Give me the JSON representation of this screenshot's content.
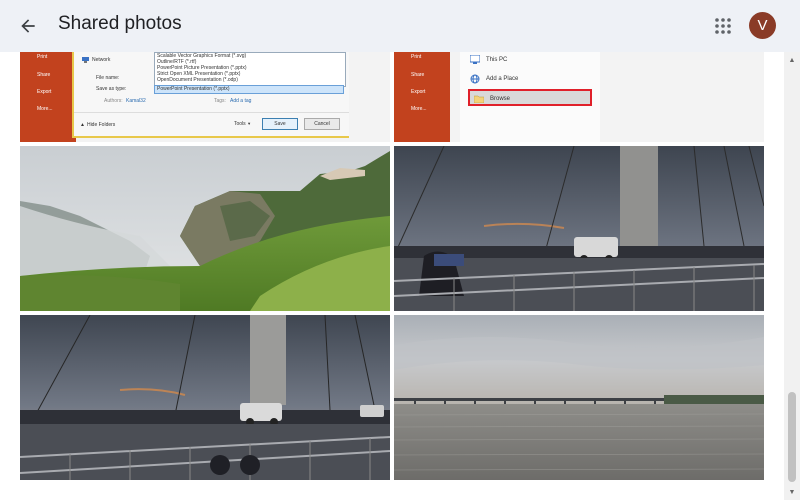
{
  "header": {
    "title": "Shared photos",
    "avatar_letter": "V",
    "back_icon": "arrow-left-icon",
    "apps_icon": "apps-grid-icon"
  },
  "tile1": {
    "sidebar": [
      "Print",
      "Share",
      "Export",
      "More..."
    ],
    "network_label": "Network",
    "file_types": [
      "Scalable Vector Graphics Format (*.svg)",
      "Outline/RTF (*.rtf)",
      "PowerPoint Picture Presentation (*.pptx)",
      "Strict Open XML Presentation (*.pptx)",
      "OpenDocument Presentation (*.odp)"
    ],
    "file_name_label": "File name:",
    "save_type_label": "Save as type:",
    "save_type_value": "PowerPoint Presentation (*.pptx)",
    "authors_label": "Authors:",
    "authors_value": "Kamal32",
    "tags_label": "Tags:",
    "tags_value": "Add a tag",
    "hide_folders": "Hide Folders",
    "tools_label": "Tools",
    "save_label": "Save",
    "cancel_label": "Cancel"
  },
  "tile2": {
    "sidebar": [
      "Print",
      "Share",
      "Export",
      "More..."
    ],
    "this_pc": "This PC",
    "add_place": "Add a Place",
    "browse": "Browse"
  },
  "colors": {
    "header_bg": "#eef1f6",
    "avatar_bg": "#8a3b27",
    "ppt_orange": "#c2421e",
    "highlight_red": "#e0202a"
  }
}
